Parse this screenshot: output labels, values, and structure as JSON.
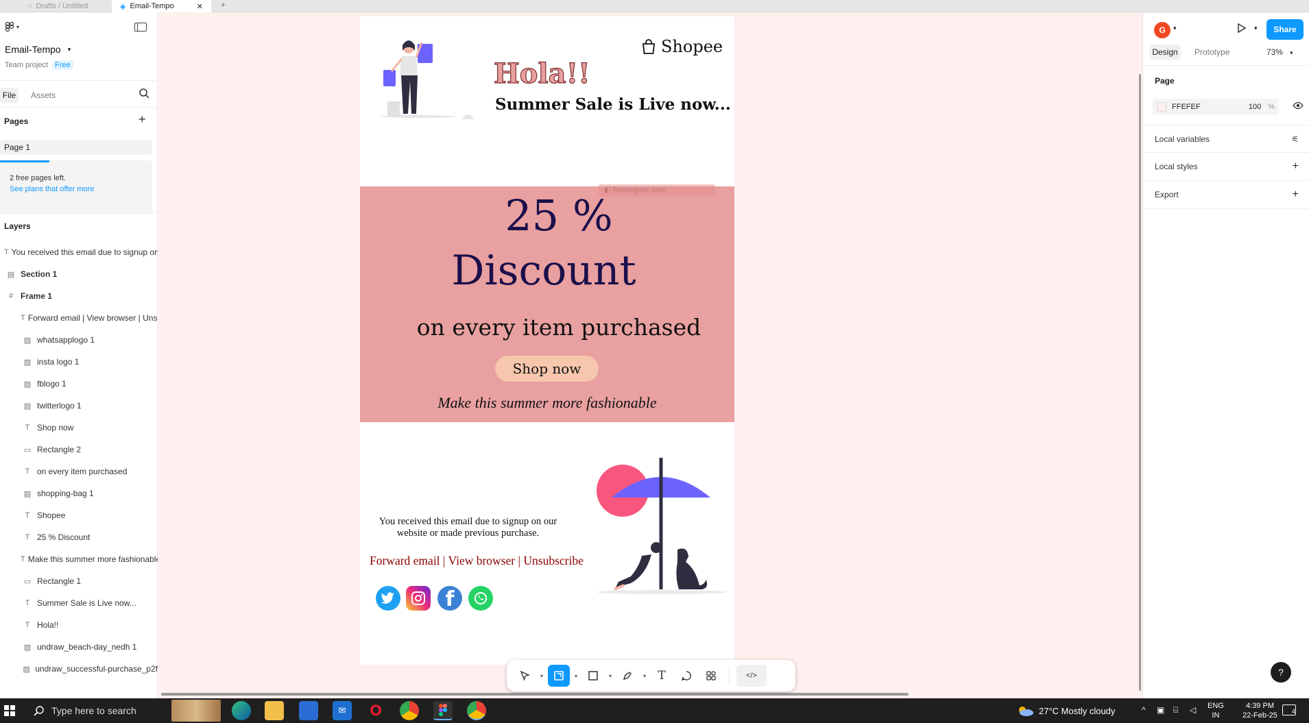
{
  "tabs": [
    {
      "label": "Drafts / Untitled"
    },
    {
      "label": "Email-Tempo"
    }
  ],
  "left": {
    "file_name": "Email-Tempo",
    "team": "Team project",
    "plan": "Free",
    "tab_file": "File",
    "tab_assets": "Assets",
    "pages_title": "Pages",
    "page1": "Page 1",
    "free_pages": "2 free pages left.",
    "see_plans": "See plans that offer more",
    "layers_title": "Layers",
    "layers": [
      {
        "icon": "T",
        "label": "You received this email due to signup on our website",
        "indent": 0
      },
      {
        "icon": "▤",
        "label": "Section 1",
        "indent": 0,
        "bold": true
      },
      {
        "icon": "#",
        "label": "Frame 1",
        "indent": 0,
        "bold": true
      },
      {
        "icon": "T",
        "label": "Forward email | View browser | Unsubscribe",
        "indent": 1
      },
      {
        "icon": "▨",
        "label": "whatsapplogo 1",
        "indent": 1
      },
      {
        "icon": "▨",
        "label": "insta logo 1",
        "indent": 1
      },
      {
        "icon": "▨",
        "label": "fblogo 1",
        "indent": 1
      },
      {
        "icon": "▨",
        "label": "twitterlogo 1",
        "indent": 1
      },
      {
        "icon": "T",
        "label": "Shop now",
        "indent": 1
      },
      {
        "icon": "▭",
        "label": "Rectangle 2",
        "indent": 1
      },
      {
        "icon": "T",
        "label": "on every item purchased",
        "indent": 1
      },
      {
        "icon": "▨",
        "label": "shopping-bag 1",
        "indent": 1
      },
      {
        "icon": "T",
        "label": "Shopee",
        "indent": 1
      },
      {
        "icon": "T",
        "label": "25 % Discount",
        "indent": 1
      },
      {
        "icon": "T",
        "label": "Make this summer more fashionable",
        "indent": 1
      },
      {
        "icon": "▭",
        "label": "Rectangle 1",
        "indent": 1
      },
      {
        "icon": "T",
        "label": "Summer Sale is Live now...",
        "indent": 1
      },
      {
        "icon": "T",
        "label": "Hola!!",
        "indent": 1
      },
      {
        "icon": "▨",
        "label": "undraw_beach-day_nedh 1",
        "indent": 1
      },
      {
        "icon": "▨",
        "label": "undraw_successful-purchase_p2f",
        "indent": 1
      }
    ]
  },
  "email": {
    "brand": "Shopee",
    "hola": "Hola!!",
    "sale": "Summer Sale is Live now...",
    "discount_pct": "25 %",
    "discount_word": "Discount",
    "every_item": "on every item purchased",
    "shop_now": "Shop now",
    "tagline": "Make this summer more fashionable",
    "received_line1": "You received this email due to signup on our",
    "received_line2": "website or made previous purchase.",
    "forward": "Forward email",
    "sep": "|",
    "view": "View browser",
    "unsub": "Unsubscribe",
    "ghost_label": "Rectangular Snip"
  },
  "right": {
    "avatar": "G",
    "share": "Share",
    "tab_design": "Design",
    "tab_prototype": "Prototype",
    "zoom": "73%",
    "page_title": "Page",
    "page_color": "FFEFEF",
    "page_opacity": "100",
    "pct": "%",
    "local_variables": "Local variables",
    "local_styles": "Local styles",
    "export": "Export"
  },
  "taskbar": {
    "search": "Type here to search",
    "weather": "27°C  Mostly cloudy",
    "lang1": "ENG",
    "lang2": "IN",
    "time": "4:39 PM",
    "date": "22-Feb-25",
    "notif": "4"
  },
  "colors": {
    "accent": "#0d99ff",
    "canvas": "#ffefef",
    "banner": "#e9a0a0",
    "navy": "#1a0f4a",
    "maroon": "#8b0000",
    "purple": "#6c63ff",
    "pink": "#f8567e"
  }
}
